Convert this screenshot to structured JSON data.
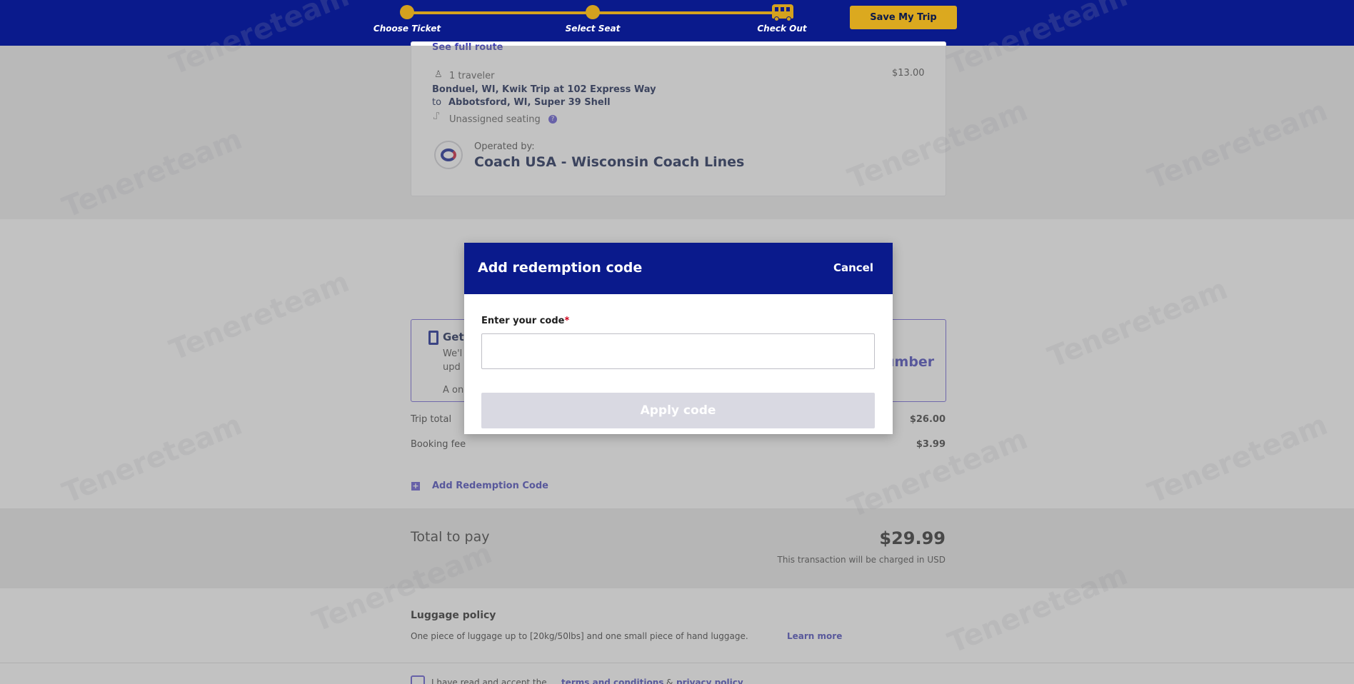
{
  "header": {
    "steps": [
      {
        "label": "Choose Ticket"
      },
      {
        "label": "Select Seat"
      },
      {
        "label": "Check Out"
      }
    ],
    "save_button": "Save My Trip"
  },
  "trip": {
    "see_full_route": "See full route",
    "travelers": "1 traveler",
    "price": "$13.00",
    "origin": "Bonduel, WI, Kwik Trip at 102 Express Way",
    "to_word": "to",
    "destination": "Abbotsford, WI, Super 39 Shell",
    "seating": "Unassigned seating",
    "operated_by_label": "Operated by:",
    "operator": "Coach USA - Wisconsin Coach Lines"
  },
  "phone_box": {
    "title": "Get",
    "line1": "We'l",
    "line2": "upd",
    "line3": "A on",
    "right_fragment": "umber"
  },
  "summary": {
    "trip_total_label": "Trip total",
    "trip_total_value": "$26.00",
    "booking_fee_label": "Booking fee",
    "booking_fee_value": "$3.99",
    "add_redemption": "Add Redemption Code",
    "total_label": "Total to pay",
    "total_value": "$29.99",
    "currency_note": "This transaction will be charged in USD"
  },
  "luggage": {
    "title": "Luggage policy",
    "text": "One piece of luggage up to [20kg/50lbs] and one small piece of hand luggage.",
    "learn_more": "Learn more"
  },
  "terms": {
    "prefix": "I have read and accept the",
    "terms_link": "terms and conditions",
    "amp": "&",
    "privacy_link": "privacy policy"
  },
  "modal": {
    "title": "Add redemption code",
    "cancel": "Cancel",
    "code_label": "Enter your code",
    "required_mark": "*",
    "code_value": "",
    "apply_button": "Apply code"
  },
  "watermark": "Tenereteam",
  "colors": {
    "brand_navy": "#0a1a8c",
    "accent_gold": "#d4a11e",
    "link_purple": "#3f3fb8"
  }
}
